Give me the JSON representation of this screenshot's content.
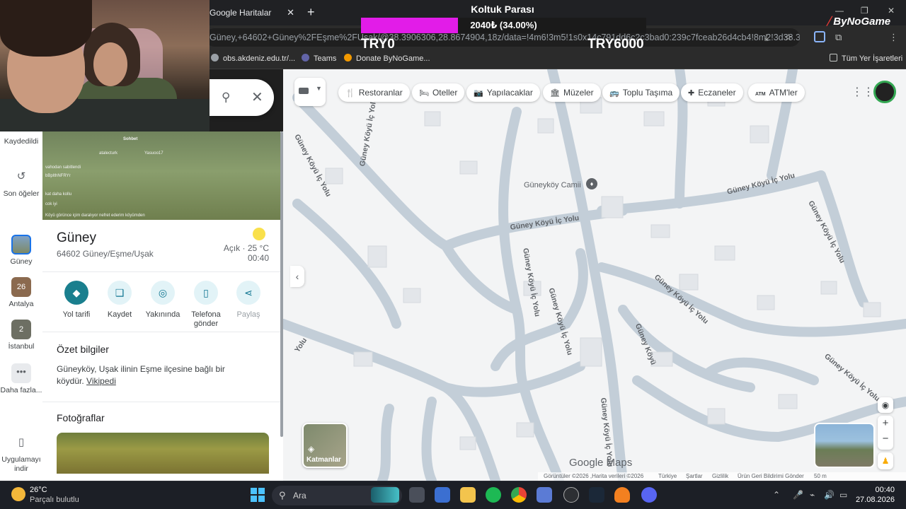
{
  "browser": {
    "tab_title": "Google Haritalar",
    "tab_close": "✕",
    "new_tab": "+",
    "url": "Güney,+64602+Güney%2FEşme%2FUşak/@38.3906306,28.8674904,18z/data=!4m6!3m5!1s0x14c791dd6c2c3bad0:239c7fceab26d4cb4!8m2!3d38.389...",
    "bookmarks": [
      {
        "label": "obs.akdeniz.edu.tr/..."
      },
      {
        "label": "Teams"
      },
      {
        "label": "Donate ByNoGame..."
      }
    ],
    "all_bookmarks": "Tüm Yer İşaretleri",
    "window_controls": {
      "minimize": "—",
      "restore": "❐",
      "close": "✕"
    }
  },
  "donation": {
    "title": "Koltuk Parası",
    "amount": "2040₺ (34.00%)",
    "progress_percent": 34,
    "min_label": "TRY0",
    "max_label": "TRY6000",
    "brand": "ByNoGame"
  },
  "rail": {
    "saved": "Kaydedildi",
    "recent": "Son öğeler",
    "items": [
      {
        "label": "Güney",
        "badge": ""
      },
      {
        "label": "Antalya",
        "badge": "26"
      },
      {
        "label": "İstanbul",
        "badge": "2"
      }
    ],
    "more": "Daha fazla...",
    "download_app": "Uygulamayı indir"
  },
  "place": {
    "name": "Güney",
    "address": "64602 Güney/Eşme/Uşak",
    "weather": "Açık · 25 °C",
    "local_time": "00:40",
    "actions": [
      {
        "label": "Yol tarifi",
        "icon": "◆"
      },
      {
        "label": "Kaydet",
        "icon": "❑"
      },
      {
        "label": "Yakınında",
        "icon": "◎"
      },
      {
        "label": "Telefona gönder",
        "icon": "▯"
      },
      {
        "label": "Paylaş",
        "icon": "⋖"
      }
    ],
    "summary_heading": "Özet bilgiler",
    "summary_text": "Güneyköy, Uşak ilinin Eşme ilçesine bağlı bir köydür.",
    "summary_link": "Vikipedi",
    "photos_heading": "Fotoğraflar",
    "photo_overlay": {
      "chat_label": "Sohbet",
      "user1": "atalecturk",
      "user2": "Yasuoo17",
      "line1": "vahodan sabitlendi",
      "line2": "bBpIthNFRYr",
      "line3": "kat daha kollu",
      "line4": "cok iyi",
      "caption": "Köyü görünce içim daralıyor nefret ederim köyümden"
    }
  },
  "map": {
    "categories": [
      {
        "label": "Restoranlar",
        "icon": "🍴"
      },
      {
        "label": "Oteller",
        "icon": "🛏"
      },
      {
        "label": "Yapılacaklar",
        "icon": "📷"
      },
      {
        "label": "Müzeler",
        "icon": "🏛"
      },
      {
        "label": "Toplu Taşıma",
        "icon": "🚌"
      },
      {
        "label": "Eczaneler",
        "icon": "✚"
      },
      {
        "label": "ATM'ler",
        "icon": "ATM"
      }
    ],
    "poi": "Güneyköy Camii",
    "roads": [
      "Güney Köyü İç Yolu",
      "Güney Köyü İç Yolu",
      "Güney Köyü İç Yolu",
      "Güney Köyü İç Yolu",
      "Güney Köyü İç Yolu",
      "Güney Köyü İç Yolu",
      "Güney Köyü",
      "Güney Köyü İç Yolu",
      "Güney Köyü İç Yolu",
      "Güney Köyü İç Yolu",
      "Güney Köyü İç Yolu",
      "Yolu"
    ],
    "layers_label": "Katmanlar",
    "logo": "Google Maps",
    "attribution": {
      "imagery": "Görüntüler ©2026 ,Harita verileri ©2026",
      "country": "Türkiye",
      "terms": "Şartlar",
      "privacy": "Gizlilik",
      "feedback": "Ürün Geri Bildirimi Gönder",
      "scale": "50 m"
    }
  },
  "taskbar": {
    "temp": "26°C",
    "condition": "Parçalı bulutlu",
    "search": "Ara",
    "time": "00:40",
    "date": "27.08.2026"
  }
}
